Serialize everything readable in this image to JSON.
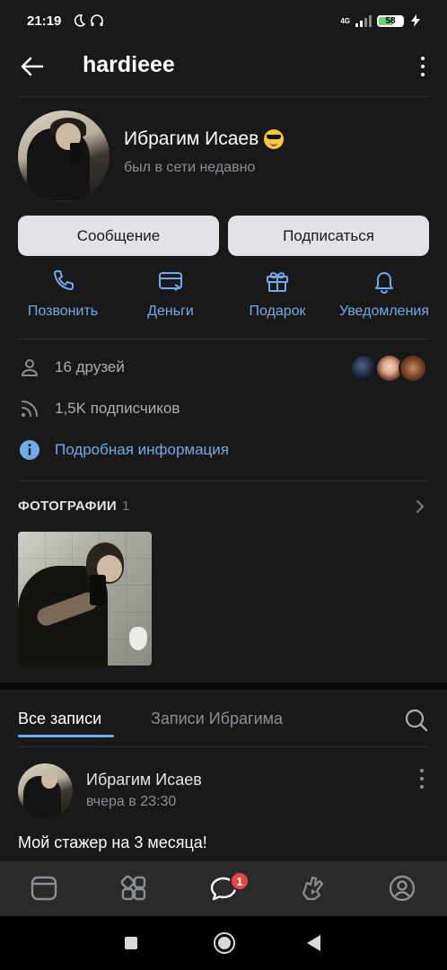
{
  "status_bar": {
    "time": "21:19",
    "network": "4G",
    "battery": "58"
  },
  "header": {
    "title": "hardieee"
  },
  "profile": {
    "name": "Ибрагим Исаев",
    "status": "был в сети недавно",
    "emoji": "sunglasses-emoji"
  },
  "buttons": {
    "message": "Сообщение",
    "subscribe": "Подписаться"
  },
  "actions": [
    {
      "label": "Позвонить",
      "icon": "phone-icon"
    },
    {
      "label": "Деньги",
      "icon": "card-icon"
    },
    {
      "label": "Подарок",
      "icon": "gift-icon"
    },
    {
      "label": "Уведомления",
      "icon": "bell-icon"
    }
  ],
  "info": {
    "friends": "16 друзей",
    "subscribers": "1,5K подписчиков",
    "details": "Подробная информация"
  },
  "photos": {
    "title": "ФОТОГРАФИИ",
    "count": "1"
  },
  "wall_tabs": {
    "all": "Все записи",
    "user": "Записи Ибрагима"
  },
  "post": {
    "author": "Ибрагим Исаев",
    "time": "вчера в 23:30",
    "text": "Мой стажер на 3 месяца!"
  },
  "tabbar": {
    "messages_badge": "1",
    "items": [
      "home-icon",
      "services-icon",
      "messages-icon",
      "clips-icon",
      "profile-icon"
    ]
  },
  "colors": {
    "background": "#19191a",
    "accent": "#71aaeb",
    "button_bg": "#e1e3e6",
    "badge": "#e64646"
  }
}
